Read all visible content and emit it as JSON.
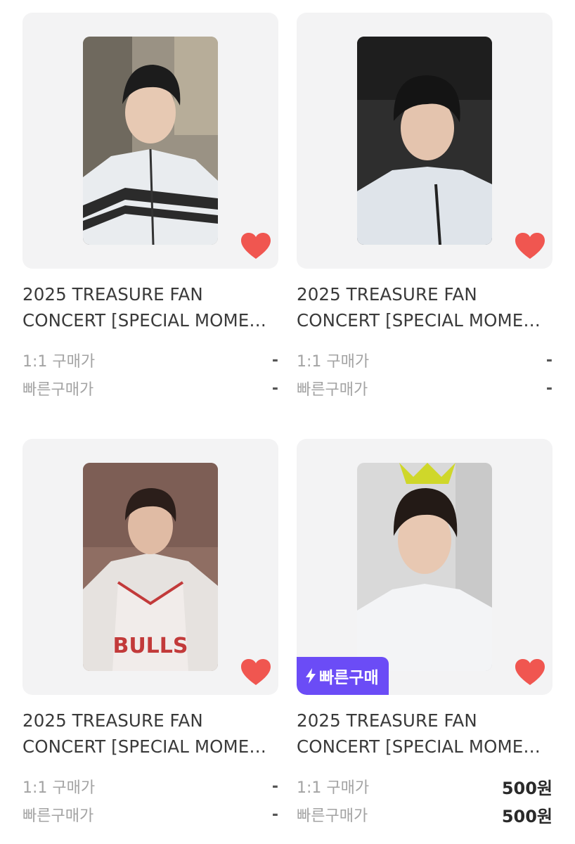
{
  "products": [
    {
      "title_line1": "2025 TREASURE FAN",
      "title_line2": "CONCERT [SPECIAL MOMEN...",
      "price_rows": [
        {
          "label": "1:1 구매가",
          "value": "-"
        },
        {
          "label": "빠른구매가",
          "value": "-"
        }
      ],
      "liked": true,
      "fast_badge": null
    },
    {
      "title_line1": "2025 TREASURE FAN",
      "title_line2": "CONCERT [SPECIAL MOMEN...",
      "price_rows": [
        {
          "label": "1:1 구매가",
          "value": "-"
        },
        {
          "label": "빠른구매가",
          "value": "-"
        }
      ],
      "liked": true,
      "fast_badge": null
    },
    {
      "title_line1": "2025 TREASURE FAN",
      "title_line2": "CONCERT [SPECIAL MOMEN...",
      "price_rows": [
        {
          "label": "1:1 구매가",
          "value": "-"
        },
        {
          "label": "빠른구매가",
          "value": "-"
        }
      ],
      "liked": true,
      "fast_badge": null
    },
    {
      "title_line1": "2025 TREASURE FAN",
      "title_line2": "CONCERT [SPECIAL MOMEN...",
      "price_rows": [
        {
          "label": "1:1 구매가",
          "value": "500원"
        },
        {
          "label": "빠른구매가",
          "value": "500원"
        }
      ],
      "liked": true,
      "fast_badge": "빠른구매"
    }
  ],
  "colors": {
    "heart": "#f05650",
    "badge": "#6b4cf6",
    "thumb_bg": "#f3f3f4"
  }
}
